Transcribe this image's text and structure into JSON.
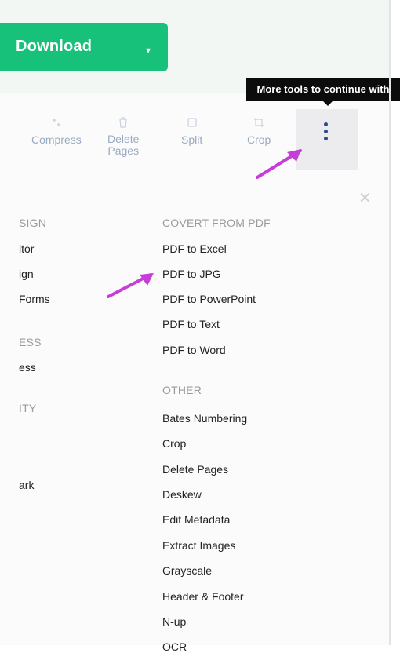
{
  "header": {
    "download_label": "Download",
    "tooltip": "More tools to continue with"
  },
  "toolbar": {
    "tools": [
      {
        "label": "Compress"
      },
      {
        "label": "Delete\nPages"
      },
      {
        "label": "Split"
      },
      {
        "label": "Crop"
      }
    ]
  },
  "left_column": {
    "sign_title": "SIGN",
    "items_1": [
      "itor",
      "ign",
      "Forms"
    ],
    "compress_title": "ESS",
    "items_2": [
      "ess"
    ],
    "security_title": "ITY",
    "items_3": [
      "ark"
    ]
  },
  "right_column": {
    "convert_title": "COVERT FROM PDF",
    "convert_items": [
      "PDF to Excel",
      "PDF to JPG",
      "PDF to PowerPoint",
      "PDF to Text",
      "PDF to Word"
    ],
    "other_title": "OTHER",
    "other_items": [
      "Bates Numbering",
      "Crop",
      "Delete Pages",
      "Deskew",
      "Edit Metadata",
      "Extract Images",
      "Grayscale",
      "Header & Footer",
      "N-up",
      "OCR"
    ]
  },
  "colors": {
    "accent": "#18c17a",
    "arrow": "#c63dd7"
  }
}
